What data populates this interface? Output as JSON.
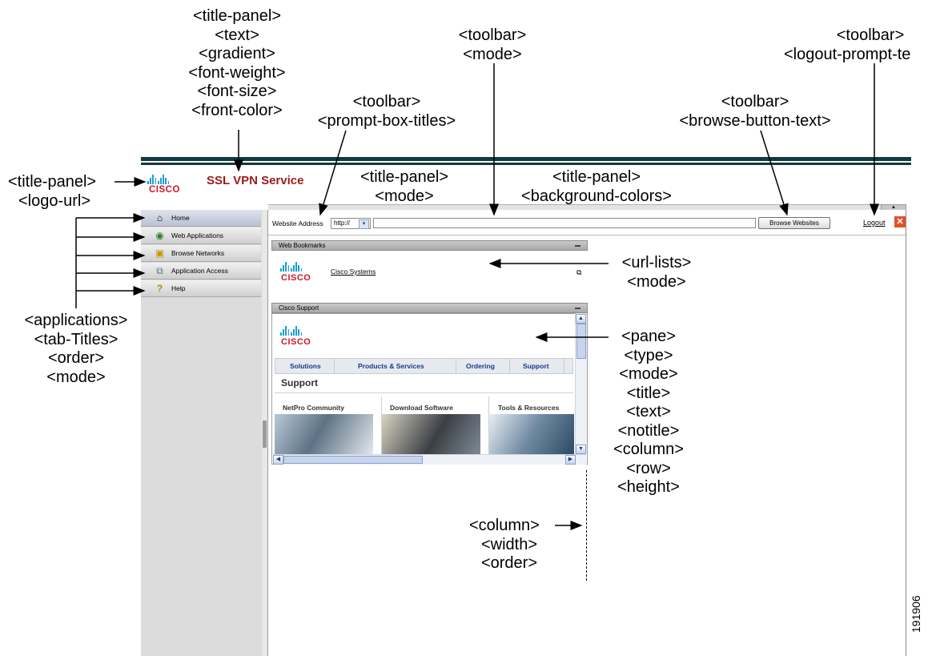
{
  "callouts": {
    "title_panel_main": [
      "<title-panel>",
      "<text>",
      "<gradient>",
      "<font-weight>",
      "<font-size>",
      "<front-color>"
    ],
    "toolbar_mode": [
      "<toolbar>",
      "<mode>"
    ],
    "toolbar_logout": [
      "<toolbar>",
      "<logout-prompt-te"
    ],
    "toolbar_prompt": [
      "<toolbar>",
      "<prompt-box-titles>"
    ],
    "toolbar_browse": [
      "<toolbar>",
      "<browse-button-text>"
    ],
    "title_panel_logo": [
      "<title-panel>",
      "<logo-url>"
    ],
    "title_panel_mode": [
      "<title-panel>",
      "<mode>"
    ],
    "title_panel_bg": [
      "<title-panel>",
      "<background-colors>"
    ],
    "applications": [
      "<applications>",
      "<tab-Titles>",
      "<order>",
      "<mode>"
    ],
    "url_lists": [
      "<url-lists>",
      "<mode>"
    ],
    "pane": [
      "<pane>",
      "<type>",
      "<mode>",
      "<title>",
      "<text>",
      "<notitle>",
      "<column>",
      "<row>",
      "<height>"
    ],
    "column": [
      "<column>",
      "<width>",
      "<order>"
    ]
  },
  "header": {
    "logo_word": "CISCO",
    "service_title": "SSL VPN Service",
    "band_color": "#123a40",
    "title_color": "#9b1b1b"
  },
  "sidebar": {
    "items": [
      {
        "label": "Home",
        "icon": "home-icon"
      },
      {
        "label": "Web Applications",
        "icon": "globe-icon"
      },
      {
        "label": "Browse Networks",
        "icon": "network-folder-icon"
      },
      {
        "label": "Application Access",
        "icon": "application-access-icon"
      },
      {
        "label": "Help",
        "icon": "help-icon"
      }
    ]
  },
  "toolbar": {
    "address_label": "Website Address",
    "protocol_value": "http://",
    "url_value": "",
    "browse_label": "Browse Websites",
    "logout_label": "Logout"
  },
  "bookmarks_pane": {
    "title": "Web Bookmarks",
    "logo_word": "CISCO",
    "link": "Cisco Systems"
  },
  "support_pane": {
    "title": "Cisco Support",
    "logo_word": "CISCO",
    "nav": [
      "Solutions",
      "Products & Services",
      "Ordering",
      "Support"
    ],
    "heading": "Support",
    "columns": [
      "NetPro Community",
      "Download Software",
      "Tools & Resources"
    ]
  },
  "figure_id": "191906"
}
